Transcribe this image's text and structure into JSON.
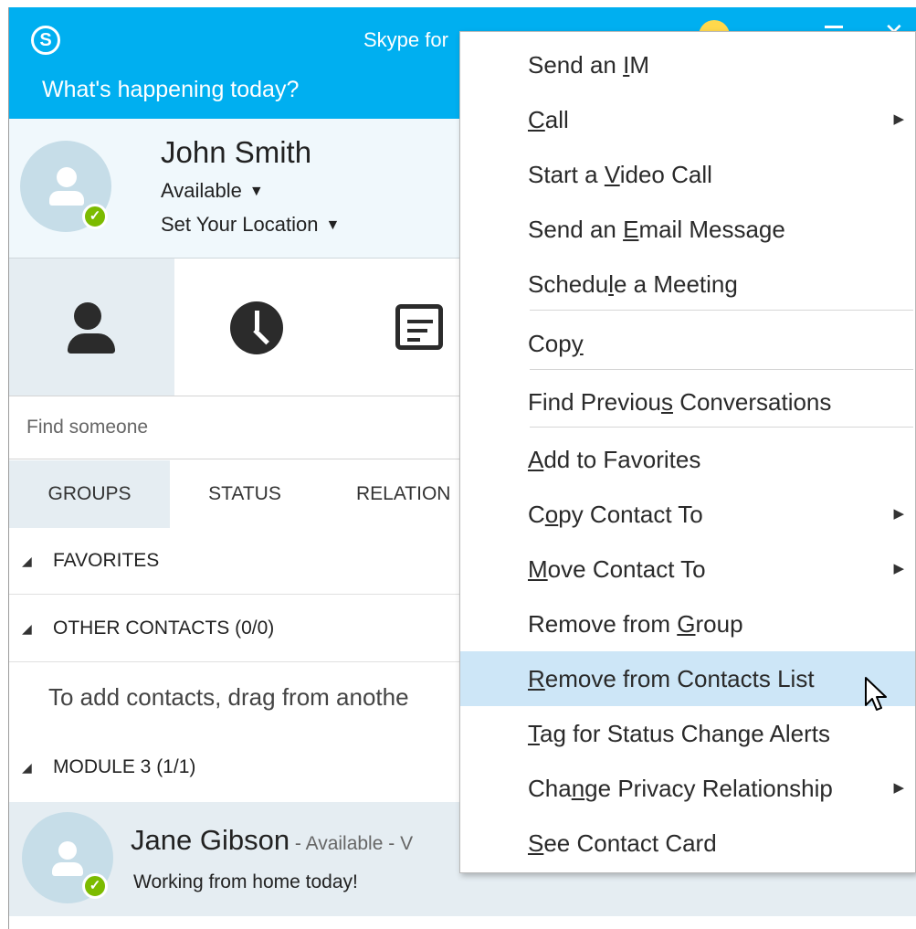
{
  "window": {
    "app_title": "Skype for",
    "whats_happening": "What's happening today?"
  },
  "profile": {
    "name": "John Smith",
    "status": "Available",
    "location": "Set Your Location"
  },
  "search": {
    "placeholder": "Find someone"
  },
  "group_tabs": [
    "GROUPS",
    "STATUS",
    "RELATION"
  ],
  "groups": {
    "favorites": "FAVORITES",
    "other_contacts": "OTHER CONTACTS (0/0)",
    "empty_hint": "To add contacts, drag from anothe",
    "module3": "MODULE 3 (1/1)"
  },
  "contact": {
    "name": "Jane Gibson",
    "meta": " - Available - V",
    "note": "Working from home today!"
  },
  "colors": {
    "accent": "#00aff0",
    "presence_available": "#7cbb00",
    "menu_highlight": "#cde6f7",
    "selected_tab": "#e5edf2"
  },
  "icons": [
    "skype-logo-icon",
    "emoji-icon",
    "menu-icon",
    "close-icon",
    "contacts-icon",
    "history-icon",
    "meetings-icon",
    "submenu-arrow-icon",
    "mouse-cursor-icon"
  ],
  "context_menu": {
    "items": [
      {
        "pre": "Send an ",
        "key": "I",
        "post": "M",
        "submenu": false
      },
      {
        "pre": "",
        "key": "C",
        "post": "all",
        "submenu": true
      },
      {
        "pre": "Start a ",
        "key": "V",
        "post": "ideo Call",
        "submenu": false
      },
      {
        "pre": "Send an ",
        "key": "E",
        "post": "mail Message",
        "submenu": false
      },
      {
        "pre": "Schedu",
        "key": "l",
        "post": "e a Meeting",
        "submenu": false
      },
      {
        "pre": "Cop",
        "key": "y",
        "post": "",
        "submenu": false
      },
      {
        "pre": "Find Previou",
        "key": "s",
        "post": " Conversations",
        "submenu": false
      },
      {
        "pre": "",
        "key": "A",
        "post": "dd to Favorites",
        "submenu": false
      },
      {
        "pre": "C",
        "key": "o",
        "post": "py Contact To",
        "submenu": true
      },
      {
        "pre": "",
        "key": "M",
        "post": "ove Contact To",
        "submenu": true
      },
      {
        "pre": "Remove from ",
        "key": "G",
        "post": "roup",
        "submenu": false
      },
      {
        "pre": "",
        "key": "R",
        "post": "emove from Contacts List",
        "submenu": false,
        "highlighted": true
      },
      {
        "pre": "",
        "key": "T",
        "post": "ag for Status Change Alerts",
        "submenu": false
      },
      {
        "pre": "Cha",
        "key": "n",
        "post": "ge Privacy Relationship",
        "submenu": true
      },
      {
        "pre": "",
        "key": "S",
        "post": "ee Contact Card",
        "submenu": false
      }
    ]
  }
}
